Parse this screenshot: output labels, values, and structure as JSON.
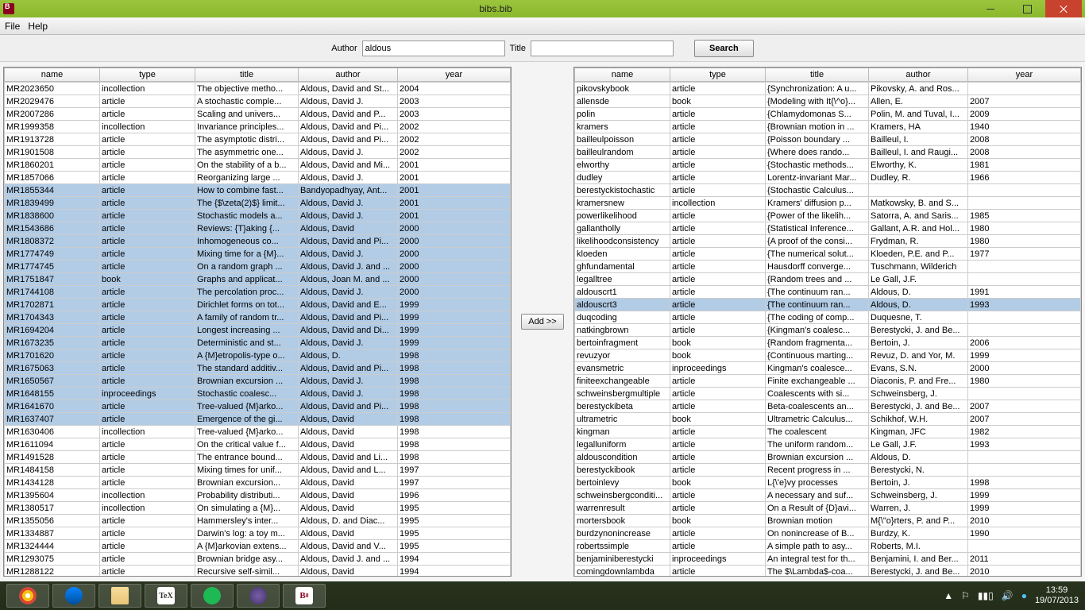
{
  "window": {
    "title": "bibs.bib"
  },
  "menu": {
    "file": "File",
    "help": "Help"
  },
  "search": {
    "author_label": "Author",
    "author_value": "aldous",
    "title_label": "Title",
    "title_value": "",
    "button": "Search"
  },
  "middle": {
    "add": "Add >>"
  },
  "columns": [
    "name",
    "type",
    "title",
    "author",
    "year"
  ],
  "left_rows": [
    {
      "sel": 0,
      "c": [
        "MR2023650",
        "incollection",
        "The objective metho...",
        "Aldous, David and St...",
        "2004"
      ]
    },
    {
      "sel": 0,
      "c": [
        "MR2029476",
        "article",
        "A stochastic comple...",
        "Aldous, David J.",
        "2003"
      ]
    },
    {
      "sel": 0,
      "c": [
        "MR2007286",
        "article",
        "Scaling and univers...",
        "Aldous, David and P...",
        "2003"
      ]
    },
    {
      "sel": 0,
      "c": [
        "MR1999358",
        "incollection",
        "Invariance principles...",
        "Aldous, David and Pi...",
        "2002"
      ]
    },
    {
      "sel": 0,
      "c": [
        "MR1913728",
        "article",
        "The asymptotic distri...",
        "Aldous, David and Pi...",
        "2002"
      ]
    },
    {
      "sel": 0,
      "c": [
        "MR1901508",
        "article",
        "The asymmetric one...",
        "Aldous, David J.",
        "2002"
      ]
    },
    {
      "sel": 0,
      "c": [
        "MR1860201",
        "article",
        "On the stability of a b...",
        "Aldous, David and Mi...",
        "2001"
      ]
    },
    {
      "sel": 0,
      "c": [
        "MR1857066",
        "article",
        "Reorganizing large ...",
        "Aldous, David J.",
        "2001"
      ]
    },
    {
      "sel": 1,
      "c": [
        "MR1855344",
        "article",
        "How to combine fast...",
        "Bandyopadhyay, Ant...",
        "2001"
      ]
    },
    {
      "sel": 1,
      "c": [
        "MR1839499",
        "article",
        "The {$\\zeta(2)$} limit...",
        "Aldous, David J.",
        "2001"
      ]
    },
    {
      "sel": 1,
      "c": [
        "MR1838600",
        "article",
        "Stochastic models a...",
        "Aldous, David J.",
        "2001"
      ]
    },
    {
      "sel": 1,
      "c": [
        "MR1543686",
        "article",
        "Reviews: {T}aking {...",
        "Aldous, David",
        "2000"
      ]
    },
    {
      "sel": 1,
      "c": [
        "MR1808372",
        "article",
        "Inhomogeneous co...",
        "Aldous, David and Pi...",
        "2000"
      ]
    },
    {
      "sel": 1,
      "c": [
        "MR1774749",
        "article",
        "Mixing time for a {M}...",
        "Aldous, David J.",
        "2000"
      ]
    },
    {
      "sel": 1,
      "c": [
        "MR1774745",
        "article",
        "On a random graph ...",
        "Aldous, David J. and ...",
        "2000"
      ]
    },
    {
      "sel": 1,
      "c": [
        "MR1751847",
        "book",
        "Graphs and applicat...",
        "Aldous, Joan M. and ...",
        "2000"
      ]
    },
    {
      "sel": 1,
      "c": [
        "MR1744108",
        "article",
        "The percolation proc...",
        "Aldous, David J.",
        "2000"
      ]
    },
    {
      "sel": 1,
      "c": [
        "MR1702871",
        "article",
        "Dirichlet forms on tot...",
        "Aldous, David and E...",
        "1999"
      ]
    },
    {
      "sel": 1,
      "c": [
        "MR1704343",
        "article",
        "A family of random tr...",
        "Aldous, David and Pi...",
        "1999"
      ]
    },
    {
      "sel": 1,
      "c": [
        "MR1694204",
        "article",
        "Longest increasing ...",
        "Aldous, David and Di...",
        "1999"
      ]
    },
    {
      "sel": 1,
      "c": [
        "MR1673235",
        "article",
        "Deterministic and st...",
        "Aldous, David J.",
        "1999"
      ]
    },
    {
      "sel": 1,
      "c": [
        "MR1701620",
        "article",
        "A {M}etropolis-type o...",
        "Aldous, D.",
        "1998"
      ]
    },
    {
      "sel": 1,
      "c": [
        "MR1675063",
        "article",
        "The standard additiv...",
        "Aldous, David and Pi...",
        "1998"
      ]
    },
    {
      "sel": 1,
      "c": [
        "MR1650567",
        "article",
        "Brownian excursion ...",
        "Aldous, David J.",
        "1998"
      ]
    },
    {
      "sel": 1,
      "c": [
        "MR1648155",
        "inproceedings",
        "Stochastic coalesc...",
        "Aldous, David J.",
        "1998"
      ]
    },
    {
      "sel": 1,
      "c": [
        "MR1641670",
        "article",
        "Tree-valued {M}arko...",
        "Aldous, David and Pi...",
        "1998"
      ]
    },
    {
      "sel": 1,
      "c": [
        "MR1637407",
        "article",
        "Emergence of the gi...",
        "Aldous, David",
        "1998"
      ]
    },
    {
      "sel": 0,
      "c": [
        "MR1630406",
        "incollection",
        "Tree-valued {M}arko...",
        "Aldous, David",
        "1998"
      ]
    },
    {
      "sel": 0,
      "c": [
        "MR1611094",
        "article",
        "On the critical value f...",
        "Aldous, David",
        "1998"
      ]
    },
    {
      "sel": 0,
      "c": [
        "MR1491528",
        "article",
        "The entrance bound...",
        "Aldous, David and Li...",
        "1998"
      ]
    },
    {
      "sel": 0,
      "c": [
        "MR1484158",
        "article",
        "Mixing times for unif...",
        "Aldous, David and L...",
        "1997"
      ]
    },
    {
      "sel": 0,
      "c": [
        "MR1434128",
        "article",
        "Brownian excursion...",
        "Aldous, David",
        "1997"
      ]
    },
    {
      "sel": 0,
      "c": [
        "MR1395604",
        "incollection",
        "Probability distributi...",
        "Aldous, David",
        "1996"
      ]
    },
    {
      "sel": 0,
      "c": [
        "MR1380517",
        "incollection",
        "On simulating a {M}...",
        "Aldous, David",
        "1995"
      ]
    },
    {
      "sel": 0,
      "c": [
        "MR1355056",
        "article",
        "Hammersley's inter...",
        "Aldous, D. and Diac...",
        "1995"
      ]
    },
    {
      "sel": 0,
      "c": [
        "MR1334887",
        "article",
        "Darwin's log: a toy m...",
        "Aldous, David",
        "1995"
      ]
    },
    {
      "sel": 0,
      "c": [
        "MR1324444",
        "article",
        "A {M}arkovian extens...",
        "Aldous, David and V...",
        "1995"
      ]
    },
    {
      "sel": 0,
      "c": [
        "MR1293075",
        "article",
        "Brownian bridge asy...",
        "Aldous, David J. and ...",
        "1994"
      ]
    },
    {
      "sel": 0,
      "c": [
        "MR1288122",
        "article",
        "Recursive self-simil...",
        "Aldous, David",
        "1994"
      ]
    }
  ],
  "right_rows": [
    {
      "sel": 0,
      "c": [
        "pikovskybook",
        "article",
        "{Synchronization: A u...",
        "Pikovsky, A. and Ros...",
        ""
      ]
    },
    {
      "sel": 0,
      "c": [
        "allensde",
        "book",
        "{Modeling with It{\\^o}...",
        "Allen, E.",
        "2007"
      ]
    },
    {
      "sel": 0,
      "c": [
        "polin",
        "article",
        "{Chlamydomonas S...",
        "Polin, M. and Tuval, I...",
        "2009"
      ]
    },
    {
      "sel": 0,
      "c": [
        "kramers",
        "article",
        "{Brownian motion in ...",
        "Kramers, HA",
        "1940"
      ]
    },
    {
      "sel": 0,
      "c": [
        "bailleulpoisson",
        "article",
        "{Poisson boundary ...",
        "Bailleul, I.",
        "2008"
      ]
    },
    {
      "sel": 0,
      "c": [
        "bailleulrandom",
        "article",
        "{Where does rando...",
        "Bailleul, I. and Raugi...",
        "2008"
      ]
    },
    {
      "sel": 0,
      "c": [
        "elworthy",
        "article",
        "{Stochastic methods...",
        "Elworthy, K.",
        "1981"
      ]
    },
    {
      "sel": 0,
      "c": [
        "dudley",
        "article",
        "Lorentz-invariant Mar...",
        "Dudley, R.",
        "1966"
      ]
    },
    {
      "sel": 0,
      "c": [
        "berestyckistochastic",
        "article",
        "{Stochastic Calculus...",
        "",
        ""
      ]
    },
    {
      "sel": 0,
      "c": [
        "kramersnew",
        "incollection",
        "Kramers' diffusion p...",
        "Matkowsky, B. and S...",
        ""
      ]
    },
    {
      "sel": 0,
      "c": [
        "powerlikelihood",
        "article",
        "{Power of the likelih...",
        "Satorra, A. and Saris...",
        "1985"
      ]
    },
    {
      "sel": 0,
      "c": [
        "gallantholly",
        "article",
        "{Statistical Inference...",
        "Gallant, A.R. and Hol...",
        "1980"
      ]
    },
    {
      "sel": 0,
      "c": [
        "likelihoodconsistency",
        "article",
        "{A proof of the consi...",
        "Frydman, R.",
        "1980"
      ]
    },
    {
      "sel": 0,
      "c": [
        "kloeden",
        "article",
        "{The numerical solut...",
        "Kloeden, P.E. and P...",
        "1977"
      ]
    },
    {
      "sel": 0,
      "c": [
        "ghfundamental",
        "article",
        "Hausdorff converge...",
        "Tuschmann, Wilderich",
        ""
      ]
    },
    {
      "sel": 0,
      "c": [
        "legalltree",
        "article",
        "{Random trees and ...",
        "Le Gall, J.F.",
        ""
      ]
    },
    {
      "sel": 0,
      "c": [
        "aldouscrt1",
        "article",
        "{The continuum ran...",
        "Aldous, D.",
        "1991"
      ]
    },
    {
      "sel": 1,
      "c": [
        "aldouscrt3",
        "article",
        "{The continuum ran...",
        "Aldous, D.",
        "1993"
      ]
    },
    {
      "sel": 0,
      "c": [
        "duqcoding",
        "article",
        "{The coding of comp...",
        "Duquesne, T.",
        ""
      ]
    },
    {
      "sel": 0,
      "c": [
        "natkingbrown",
        "article",
        "{Kingman's coalesc...",
        "Berestycki, J. and Be...",
        ""
      ]
    },
    {
      "sel": 0,
      "c": [
        "bertoinfragment",
        "book",
        "{Random fragmenta...",
        "Bertoin, J.",
        "2006"
      ]
    },
    {
      "sel": 0,
      "c": [
        "revuzyor",
        "book",
        "{Continuous marting...",
        "Revuz, D. and Yor, M.",
        "1999"
      ]
    },
    {
      "sel": 0,
      "c": [
        "evansmetric",
        "inproceedings",
        "Kingman's coalesce...",
        "Evans, S.N.",
        "2000"
      ]
    },
    {
      "sel": 0,
      "c": [
        "finiteexchangeable",
        "article",
        "Finite exchangeable ...",
        "Diaconis, P. and Fre...",
        "1980"
      ]
    },
    {
      "sel": 0,
      "c": [
        "schweinsbergmultiple",
        "article",
        "Coalescents with si...",
        "Schweinsberg, J.",
        ""
      ]
    },
    {
      "sel": 0,
      "c": [
        "berestyckibeta",
        "article",
        "Beta-coalescents an...",
        "Berestycki, J. and Be...",
        "2007"
      ]
    },
    {
      "sel": 0,
      "c": [
        "ultrametric",
        "book",
        "Ultrametric Calculus...",
        "Schikhof, W.H.",
        "2007"
      ]
    },
    {
      "sel": 0,
      "c": [
        "kingman",
        "article",
        "The coalescent",
        "Kingman, JFC",
        "1982"
      ]
    },
    {
      "sel": 0,
      "c": [
        "legalluniform",
        "article",
        "The uniform random...",
        "Le Gall, J.F.",
        "1993"
      ]
    },
    {
      "sel": 0,
      "c": [
        "aldouscondition",
        "article",
        "Brownian excursion ...",
        "Aldous, D.",
        ""
      ]
    },
    {
      "sel": 0,
      "c": [
        "berestyckibook",
        "article",
        "Recent progress in ...",
        "Berestycki, N.",
        ""
      ]
    },
    {
      "sel": 0,
      "c": [
        "bertoinlevy",
        "book",
        "L{\\'e}vy processes",
        "Bertoin, J.",
        "1998"
      ]
    },
    {
      "sel": 0,
      "c": [
        "schweinsbergconditi...",
        "article",
        "A necessary and suf...",
        "Schweinsberg, J.",
        "1999"
      ]
    },
    {
      "sel": 0,
      "c": [
        "warrenresult",
        "article",
        "On a Result of {D}avi...",
        "Warren, J.",
        "1999"
      ]
    },
    {
      "sel": 0,
      "c": [
        "mortersbook",
        "book",
        "Brownian motion",
        "M{\\\"o}rters, P. and P...",
        "2010"
      ]
    },
    {
      "sel": 0,
      "c": [
        "burdzynonincrease",
        "article",
        "On nonincrease of B...",
        "Burdzy, K.",
        "1990"
      ]
    },
    {
      "sel": 0,
      "c": [
        "robertssimple",
        "article",
        "A simple path to asy...",
        "Roberts, M.I.",
        ""
      ]
    },
    {
      "sel": 0,
      "c": [
        "benjaminiberestycki",
        "inproceedings",
        "An integral test for th...",
        "Benjamini, I. and Ber...",
        "2011"
      ]
    },
    {
      "sel": 0,
      "c": [
        "comingdownlambda",
        "article",
        "The $\\Lambda$-coa...",
        "Berestycki, J. and Be...",
        "2010"
      ]
    }
  ],
  "taskbar": {
    "chrome": "#f4c20d",
    "thunderbird": "#0a84ff",
    "explorer": "#e8c478",
    "tex": "#333",
    "spotify": "#1db954",
    "eclipse": "#3e3465",
    "bib": "#8b0020"
  },
  "tray": {
    "time": "13:59",
    "date": "19/07/2013"
  }
}
